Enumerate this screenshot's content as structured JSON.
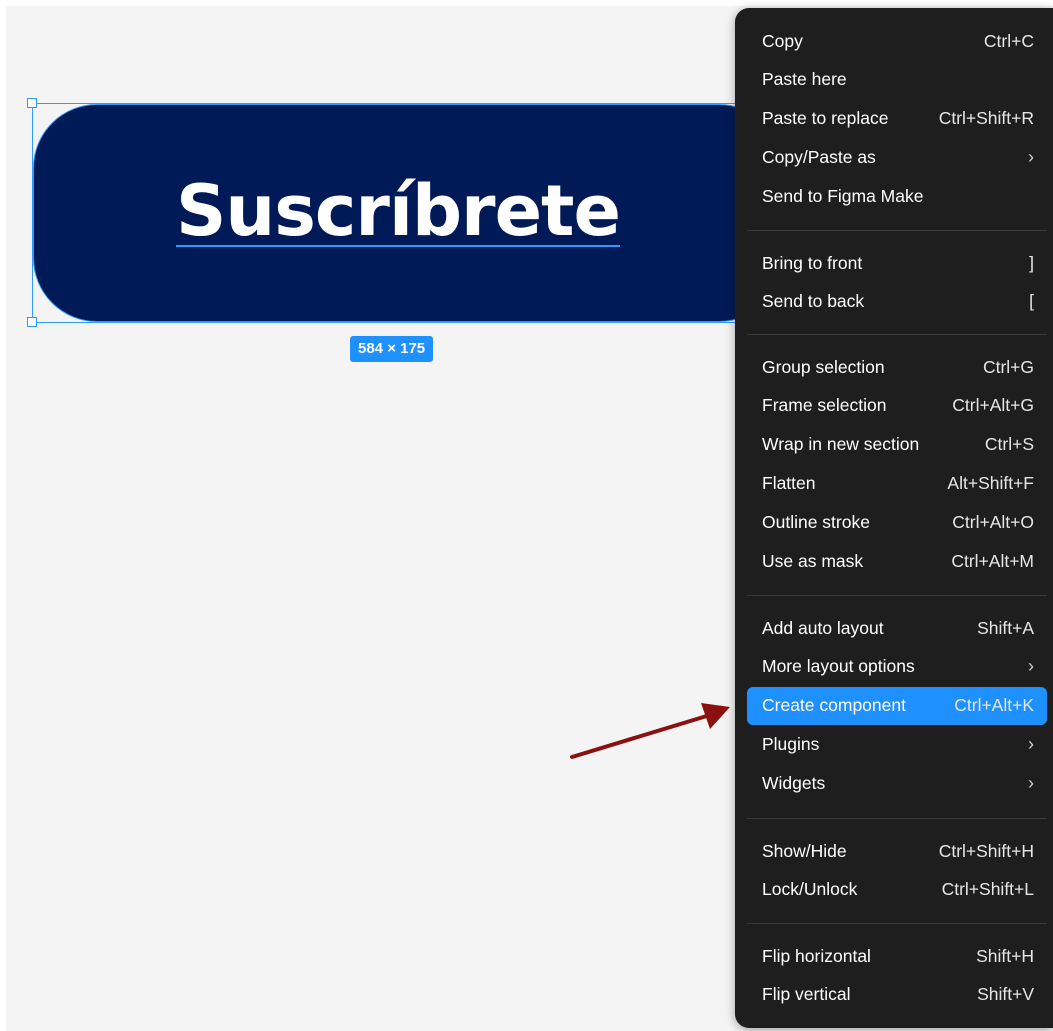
{
  "canvas": {
    "button_text": "Suscríbrete",
    "dimensions": "584 × 175",
    "button_color": "#001a57",
    "selection_color": "#2f9bff",
    "annotation_arrow_color": "#8b1010"
  },
  "menu": {
    "groups": [
      [
        {
          "label": "Copy",
          "shortcut": "Ctrl+C"
        },
        {
          "label": "Paste here",
          "shortcut": ""
        },
        {
          "label": "Paste to replace",
          "shortcut": "Ctrl+Shift+R"
        },
        {
          "label": "Copy/Paste as",
          "submenu": true
        },
        {
          "label": "Send to Figma Make",
          "shortcut": ""
        }
      ],
      [
        {
          "label": "Bring to front",
          "shortcut": "]"
        },
        {
          "label": "Send to back",
          "shortcut": "["
        }
      ],
      [
        {
          "label": "Group selection",
          "shortcut": "Ctrl+G"
        },
        {
          "label": "Frame selection",
          "shortcut": "Ctrl+Alt+G"
        },
        {
          "label": "Wrap in new section",
          "shortcut": "Ctrl+S"
        },
        {
          "label": "Flatten",
          "shortcut": "Alt+Shift+F"
        },
        {
          "label": "Outline stroke",
          "shortcut": "Ctrl+Alt+O"
        },
        {
          "label": "Use as mask",
          "shortcut": "Ctrl+Alt+M"
        }
      ],
      [
        {
          "label": "Add auto layout",
          "shortcut": "Shift+A"
        },
        {
          "label": "More layout options",
          "submenu": true
        },
        {
          "label": "Create component",
          "shortcut": "Ctrl+Alt+K",
          "highlighted": true
        },
        {
          "label": "Plugins",
          "submenu": true
        },
        {
          "label": "Widgets",
          "submenu": true
        }
      ],
      [
        {
          "label": "Show/Hide",
          "shortcut": "Ctrl+Shift+H"
        },
        {
          "label": "Lock/Unlock",
          "shortcut": "Ctrl+Shift+L"
        }
      ],
      [
        {
          "label": "Flip horizontal",
          "shortcut": "Shift+H"
        },
        {
          "label": "Flip vertical",
          "shortcut": "Shift+V"
        }
      ]
    ],
    "highlight_color": "#1e90ff",
    "background_color": "#1e1e1e"
  }
}
